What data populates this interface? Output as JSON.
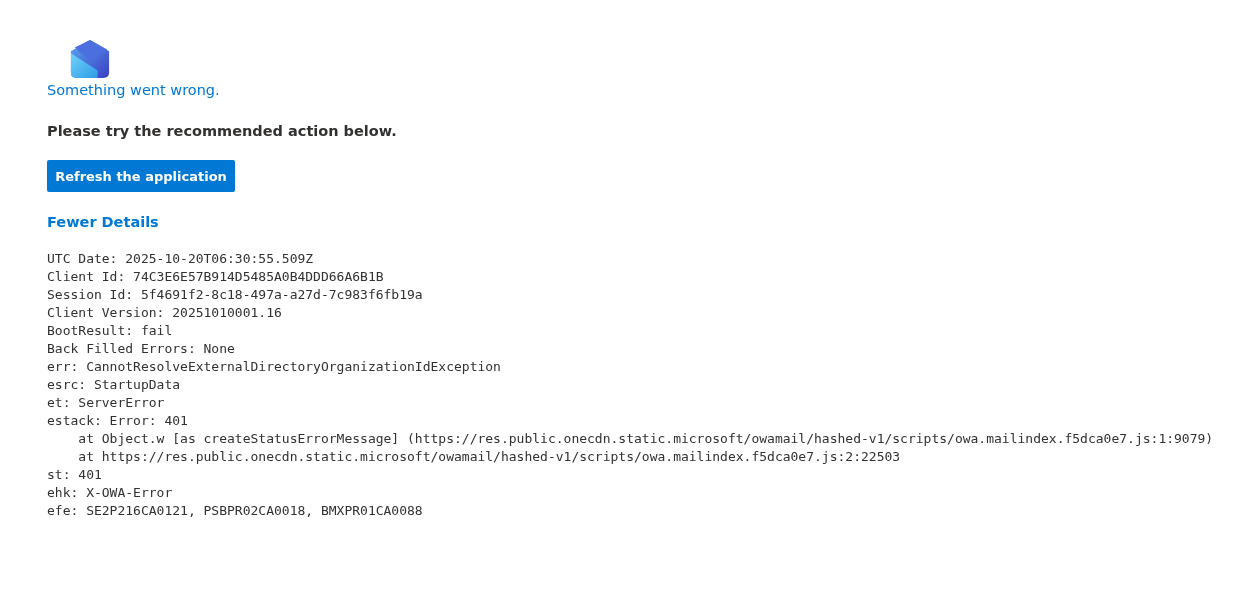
{
  "title": "Something went wrong.",
  "message": "Please try the recommended action below.",
  "button": "Refresh the application",
  "details_link": "Fewer Details",
  "details": [
    "UTC Date: 2025-10-20T06:30:55.509Z",
    "Client Id: 74C3E6E57B914D5485A0B4DDD66A6B1B",
    "Session Id: 5f4691f2-8c18-497a-a27d-7c983f6fb19a",
    "Client Version: 20251010001.16",
    "BootResult: fail",
    "Back Filled Errors: None",
    "err: CannotResolveExternalDirectoryOrganizationIdException",
    "esrc: StartupData",
    "et: ServerError",
    "estack: Error: 401",
    "    at Object.w [as createStatusErrorMessage] (https://res.public.onecdn.static.microsoft/owamail/hashed-v1/scripts/owa.mailindex.f5dca0e7.js:1:9079)",
    "    at https://res.public.onecdn.static.microsoft/owamail/hashed-v1/scripts/owa.mailindex.f5dca0e7.js:2:22503",
    "st: 401",
    "ehk: X-OWA-Error",
    "efe: SE2P216CA0121, PSBPR02CA0018, BMXPR01CA0088"
  ]
}
